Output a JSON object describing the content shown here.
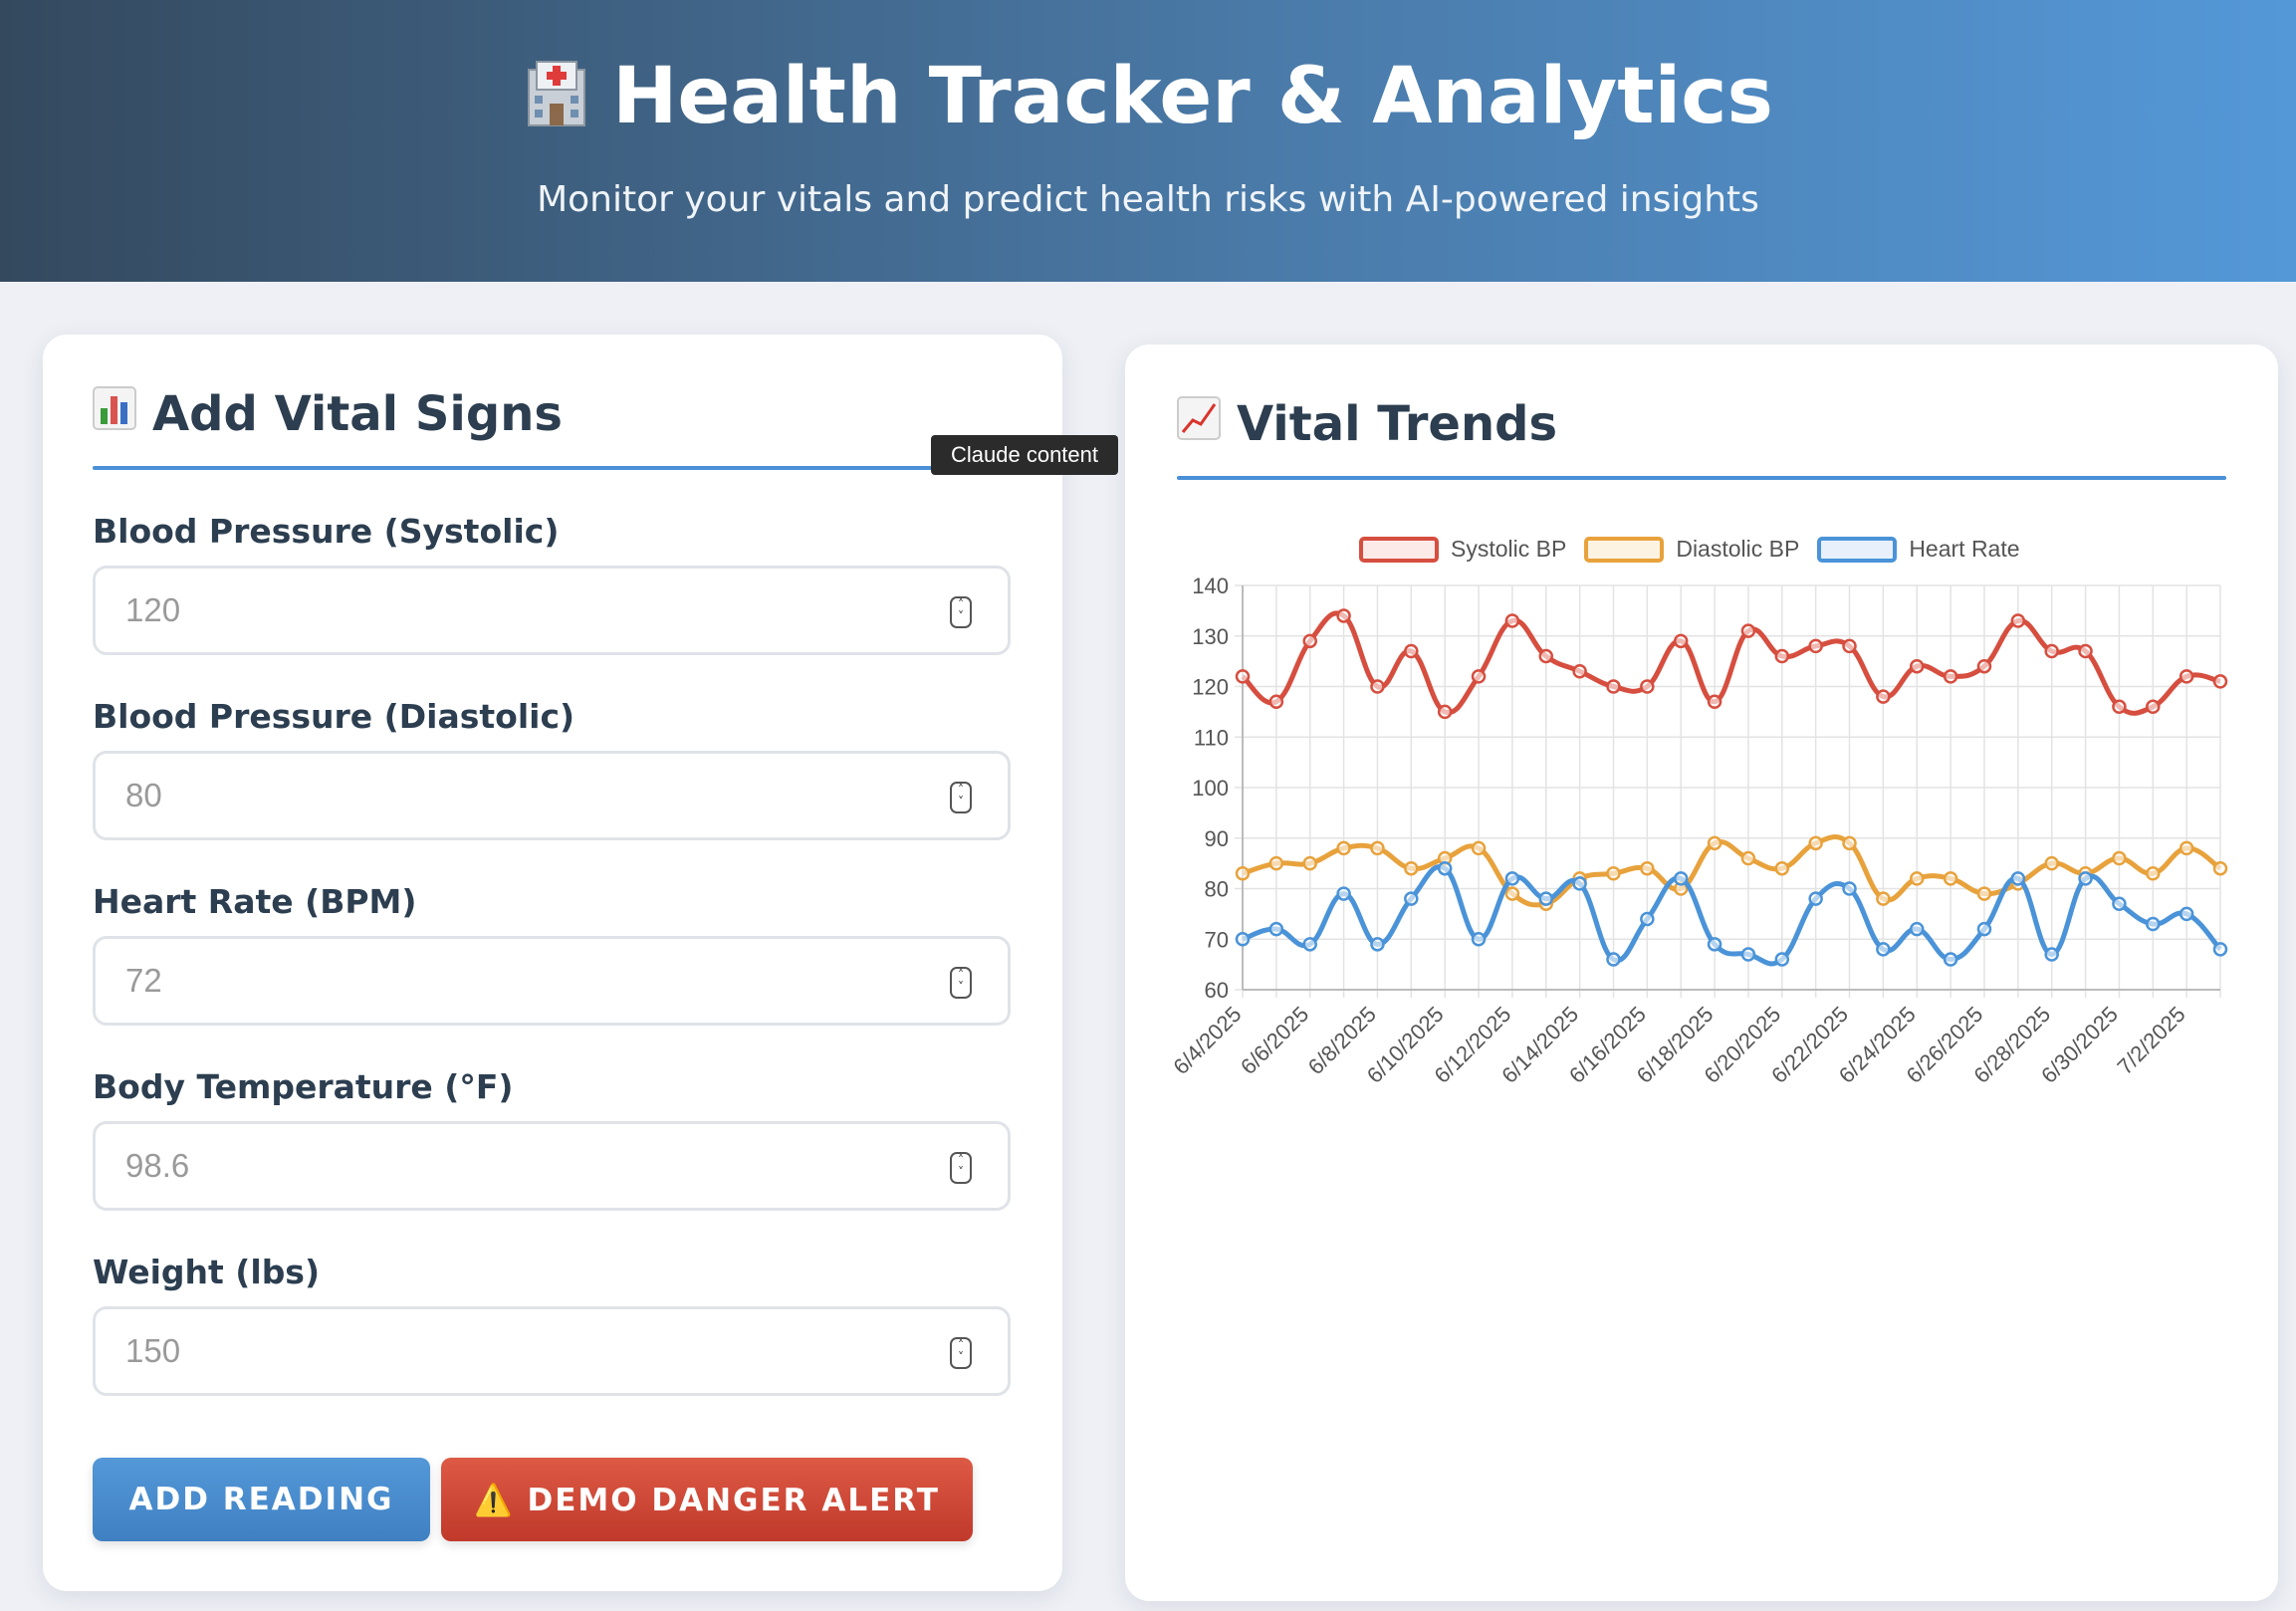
{
  "header": {
    "icon": "hospital-icon",
    "title": "Health Tracker & Analytics",
    "subtitle": "Monitor your vitals and predict health risks with AI-powered insights"
  },
  "form": {
    "title": "Add Vital Signs",
    "title_icon": "bar-chart-icon",
    "fields": [
      {
        "label": "Blood Pressure (Systolic)",
        "placeholder": "120"
      },
      {
        "label": "Blood Pressure (Diastolic)",
        "placeholder": "80"
      },
      {
        "label": "Heart Rate (BPM)",
        "placeholder": "72"
      },
      {
        "label": "Body Temperature (°F)",
        "placeholder": "98.6"
      },
      {
        "label": "Weight (lbs)",
        "placeholder": "150"
      }
    ],
    "add_button": "ADD READING",
    "danger_button": "⚠️ DEMO DANGER ALERT"
  },
  "tooltip": "Claude content",
  "trends": {
    "title": "Vital Trends",
    "title_icon": "trend-up-icon"
  },
  "colors": {
    "systolic": "#d64e3f",
    "diastolic": "#e8a23c",
    "heart_rate": "#4a93d8",
    "accent": "#4a8fd6"
  },
  "chart_data": {
    "type": "line",
    "x": [
      "6/4/2025",
      "6/5/2025",
      "6/6/2025",
      "6/7/2025",
      "6/8/2025",
      "6/9/2025",
      "6/10/2025",
      "6/11/2025",
      "6/12/2025",
      "6/13/2025",
      "6/14/2025",
      "6/15/2025",
      "6/16/2025",
      "6/17/2025",
      "6/18/2025",
      "6/19/2025",
      "6/20/2025",
      "6/21/2025",
      "6/22/2025",
      "6/23/2025",
      "6/24/2025",
      "6/25/2025",
      "6/26/2025",
      "6/27/2025",
      "6/28/2025",
      "6/29/2025",
      "6/30/2025",
      "7/1/2025",
      "7/2/2025",
      "7/3/2025"
    ],
    "tick_labels": [
      "6/4/2025",
      "6/6/2025",
      "6/8/2025",
      "6/10/2025",
      "6/12/2025",
      "6/14/2025",
      "6/16/2025",
      "6/18/2025",
      "6/20/2025",
      "6/22/2025",
      "6/24/2025",
      "6/26/2025",
      "6/28/2025",
      "6/30/2025",
      "7/2/2025"
    ],
    "series": [
      {
        "name": "Systolic BP",
        "values": [
          122,
          117,
          129,
          134,
          120,
          127,
          115,
          122,
          133,
          126,
          123,
          120,
          120,
          129,
          117,
          131,
          126,
          128,
          128,
          118,
          124,
          122,
          124,
          133,
          127,
          127,
          116,
          116,
          122,
          121
        ]
      },
      {
        "name": "Diastolic BP",
        "values": [
          83,
          85,
          85,
          88,
          88,
          84,
          86,
          88,
          79,
          77,
          82,
          83,
          84,
          80,
          89,
          86,
          84,
          89,
          89,
          78,
          82,
          82,
          79,
          81,
          85,
          83,
          86,
          83,
          88,
          84
        ]
      },
      {
        "name": "Heart Rate",
        "values": [
          70,
          72,
          69,
          79,
          69,
          78,
          84,
          70,
          82,
          78,
          81,
          66,
          74,
          82,
          69,
          67,
          66,
          78,
          80,
          68,
          72,
          66,
          72,
          82,
          67,
          82,
          77,
          73,
          75,
          68
        ]
      }
    ],
    "ylim": [
      60,
      140
    ],
    "yticks": [
      60,
      70,
      80,
      90,
      100,
      110,
      120,
      130,
      140
    ],
    "grid": true,
    "legend": "top-center"
  }
}
